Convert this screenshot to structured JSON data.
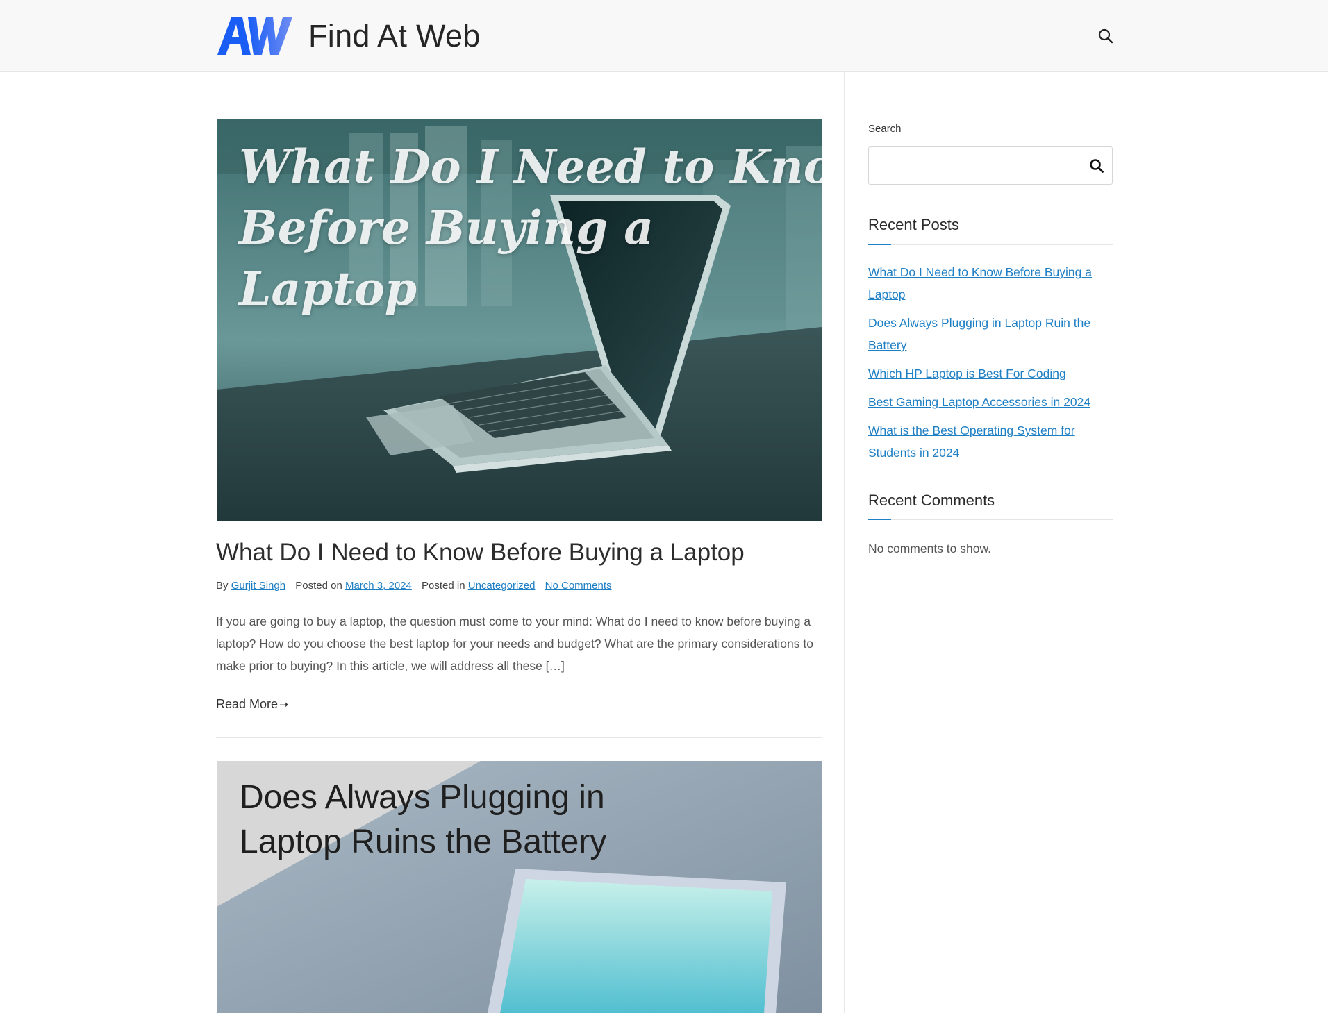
{
  "header": {
    "site_title": "Find At Web",
    "logo_text": "AW",
    "logo_colors": [
      "#1a5df5",
      "#6a86f0"
    ],
    "search_icon": "search-icon"
  },
  "posts": [
    {
      "thumbnail_text": [
        "What Do I Need to Know",
        "Before Buying a",
        "Laptop"
      ],
      "title": "What Do I Need to Know Before Buying a Laptop",
      "meta": {
        "by_label": "By",
        "author": "Gurjit Singh",
        "posted_on_label": "Posted on",
        "date": "March 3, 2024",
        "posted_in_label": "Posted in",
        "category": "Uncategorized",
        "comments": "No Comments"
      },
      "excerpt": "If you are going to buy a laptop, the question must come to your mind: What do I need to know before buying a laptop?  How do you choose the best laptop for your needs and budget? What are the primary considerations to make prior to buying? In this article, we will address all these […]",
      "read_more": "Read More",
      "read_more_icon": "arrow-right-icon"
    },
    {
      "thumbnail_text": [
        "Does Always Plugging in",
        "Laptop Ruins the Battery"
      ]
    }
  ],
  "sidebar": {
    "search_label": "Search",
    "search_value": "",
    "recent_posts_title": "Recent Posts",
    "recent_posts": [
      "What Do I Need to Know Before Buying a Laptop",
      "Does Always Plugging in Laptop Ruin the Battery",
      "Which HP Laptop is Best For Coding",
      "Best Gaming Laptop Accessories in 2024",
      "What is the Best Operating System for Students in 2024"
    ],
    "recent_comments_title": "Recent Comments",
    "recent_comments_empty": "No comments to show."
  },
  "colors": {
    "link": "#1f7fc4",
    "header_bg": "#f8f8f8",
    "accent": "#1f7fc4"
  }
}
